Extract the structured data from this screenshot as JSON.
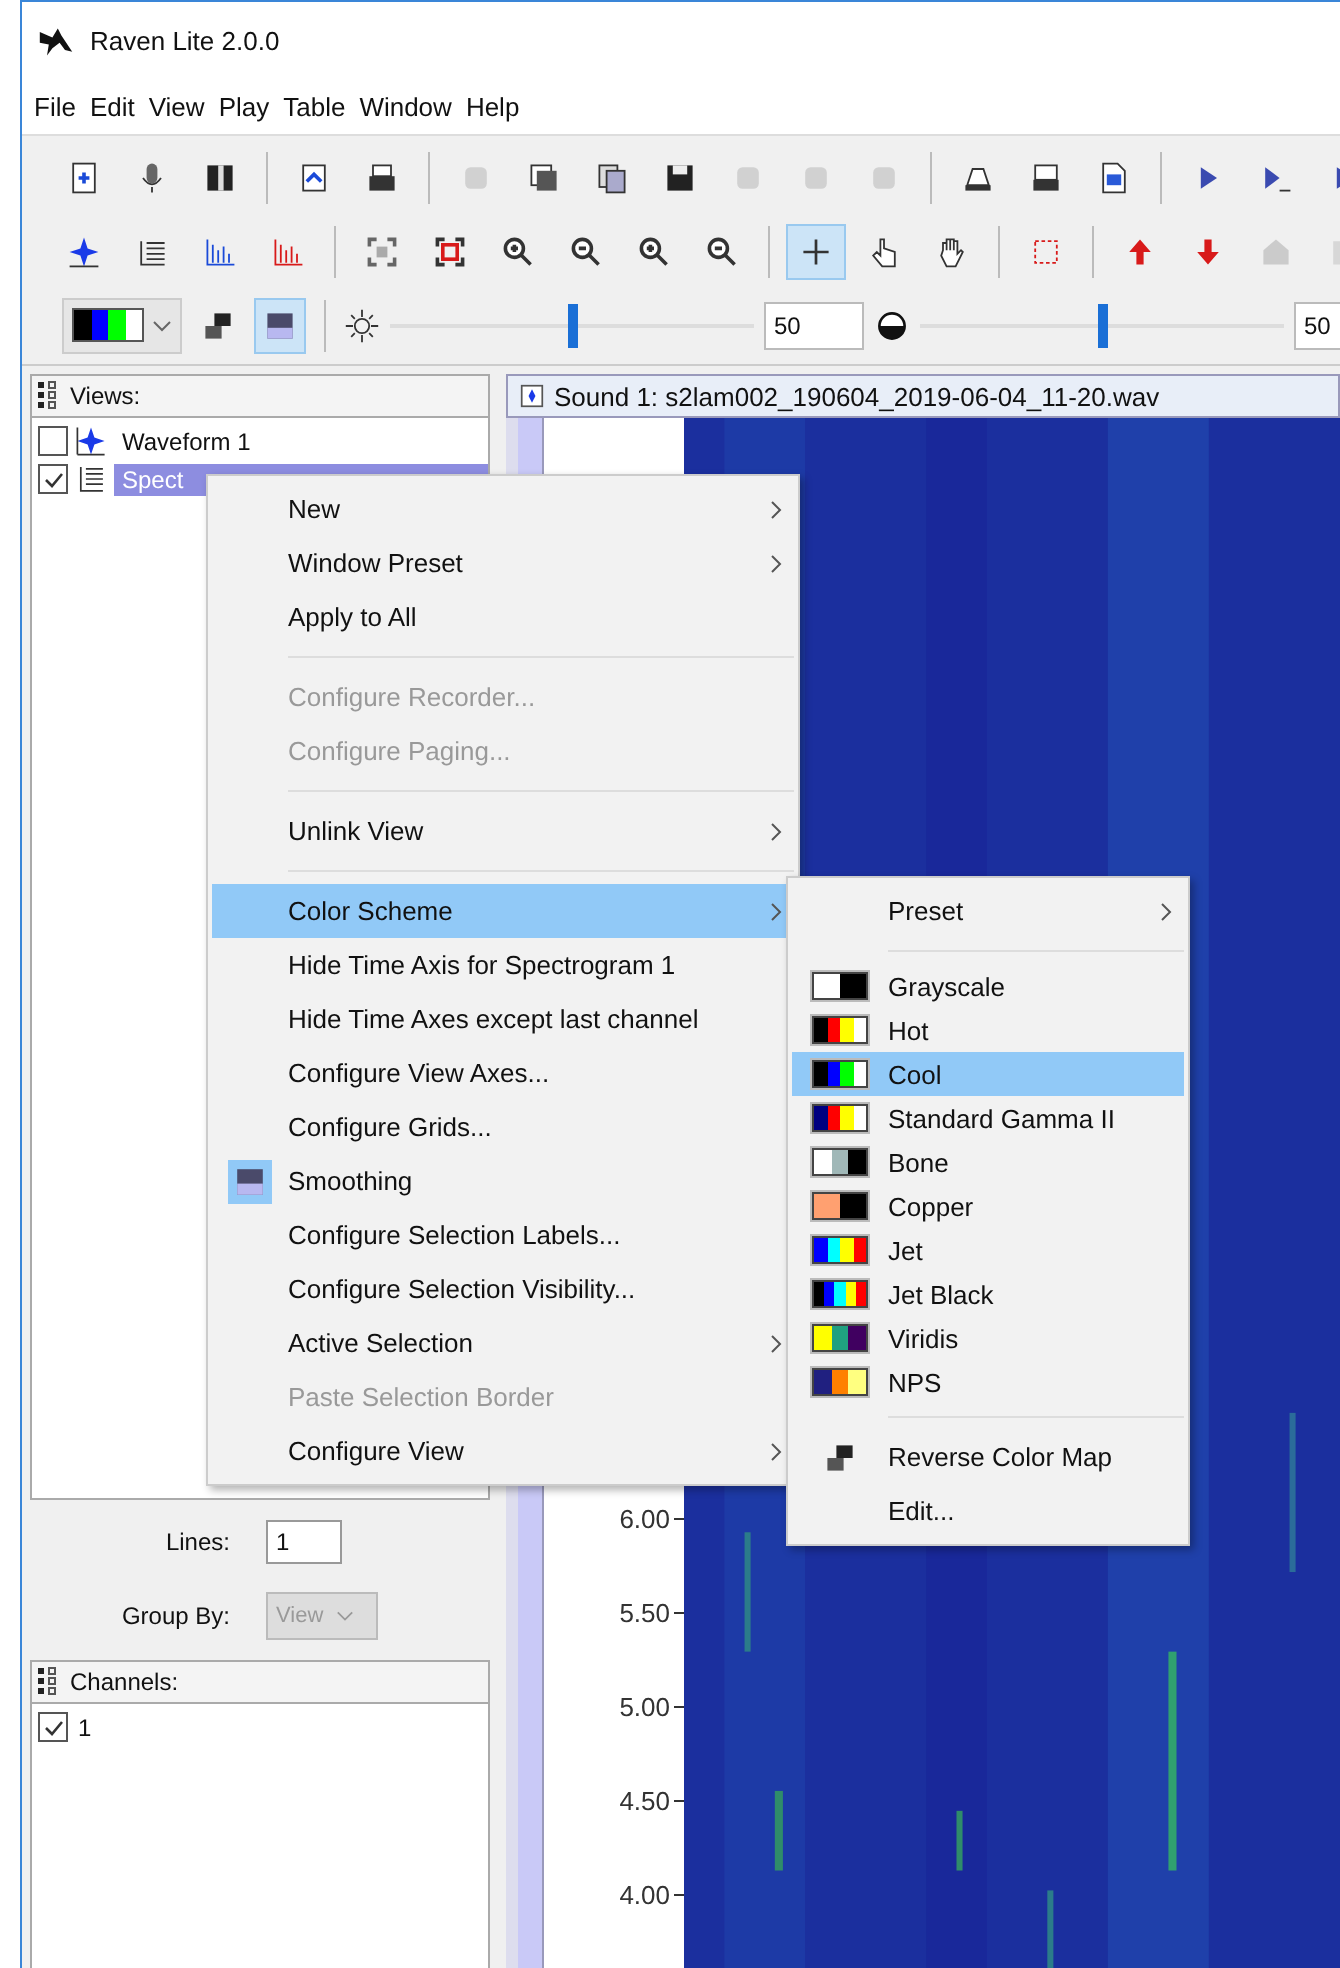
{
  "window": {
    "title": "Raven Lite 2.0.0"
  },
  "menu_bar": [
    "File",
    "Edit",
    "View",
    "Play",
    "Table",
    "Window",
    "Help"
  ],
  "toolbar_rows": [
    [
      {
        "kind": "button",
        "disabled": false,
        "selected": false
      },
      {
        "kind": "button",
        "disabled": false,
        "selected": false
      },
      {
        "kind": "button",
        "disabled": false,
        "selected": false
      },
      {
        "kind": "separator"
      },
      {
        "kind": "button",
        "disabled": false,
        "selected": false
      },
      {
        "kind": "button",
        "disabled": false,
        "selected": false
      },
      {
        "kind": "separator"
      },
      {
        "kind": "button",
        "disabled": true,
        "selected": false
      },
      {
        "kind": "button",
        "disabled": false,
        "selected": false
      },
      {
        "kind": "button",
        "disabled": false,
        "selected": false
      },
      {
        "kind": "button",
        "disabled": false,
        "selected": false
      },
      {
        "kind": "button",
        "disabled": true,
        "selected": false
      },
      {
        "kind": "button",
        "disabled": true,
        "selected": false
      },
      {
        "kind": "button",
        "disabled": true,
        "selected": false
      },
      {
        "kind": "separator"
      },
      {
        "kind": "button",
        "disabled": false,
        "selected": false
      },
      {
        "kind": "button",
        "disabled": false,
        "selected": false
      },
      {
        "kind": "button",
        "disabled": false,
        "selected": false
      },
      {
        "kind": "separator"
      },
      {
        "kind": "button",
        "disabled": false,
        "selected": false
      },
      {
        "kind": "button",
        "disabled": false,
        "selected": false
      },
      {
        "kind": "button",
        "disabled": false,
        "selected": false
      }
    ],
    [
      {
        "kind": "button",
        "disabled": false,
        "selected": false
      },
      {
        "kind": "button",
        "disabled": false,
        "selected": false
      },
      {
        "kind": "button",
        "disabled": false,
        "selected": false
      },
      {
        "kind": "button",
        "disabled": false,
        "selected": false
      },
      {
        "kind": "separator"
      },
      {
        "kind": "button",
        "disabled": false,
        "selected": false
      },
      {
        "kind": "button",
        "disabled": false,
        "selected": false
      },
      {
        "kind": "button",
        "disabled": false,
        "selected": false
      },
      {
        "kind": "button",
        "disabled": false,
        "selected": false
      },
      {
        "kind": "button",
        "disabled": false,
        "selected": false
      },
      {
        "kind": "button",
        "disabled": false,
        "selected": false
      },
      {
        "kind": "separator"
      },
      {
        "kind": "button",
        "disabled": false,
        "selected": true
      },
      {
        "kind": "button",
        "disabled": false,
        "selected": false
      },
      {
        "kind": "button",
        "disabled": false,
        "selected": false
      },
      {
        "kind": "separator"
      },
      {
        "kind": "button",
        "disabled": false,
        "selected": false
      },
      {
        "kind": "separator"
      },
      {
        "kind": "button",
        "disabled": false,
        "selected": false
      },
      {
        "kind": "button",
        "disabled": false,
        "selected": false
      },
      {
        "kind": "button",
        "disabled": true,
        "selected": false
      },
      {
        "kind": "button",
        "disabled": true,
        "selected": false
      }
    ]
  ],
  "display_controls": {
    "color_map": {
      "stops": [
        {
          "color": "#000000"
        },
        {
          "color": "#0000ff"
        },
        {
          "color": "#00ff00"
        },
        {
          "color": "#ffffff"
        }
      ]
    },
    "reverse": {
      "selected": false
    },
    "smoothing": {
      "selected": true
    },
    "brightness": {
      "level": 0.5,
      "value": "50"
    },
    "contrast": {
      "level": 0.5,
      "value": "50"
    }
  },
  "views_panel": {
    "title": "Views:",
    "items": [
      {
        "label": "Waveform 1",
        "kind": "waveform",
        "checked": false,
        "selected": false
      },
      {
        "label": "Spect",
        "kind": "spectrogram",
        "checked": true,
        "selected": true
      }
    ],
    "lines": {
      "label": "Lines:",
      "value": "1"
    },
    "group_by": {
      "label": "Group By:",
      "value": "View",
      "disabled": true
    }
  },
  "channels_panel": {
    "title": "Channels:",
    "items": [
      {
        "label": "1",
        "checked": true
      }
    ]
  },
  "sound_window": {
    "title": "Sound 1: s2lam002_190604_2019-06-04_11-20.wav",
    "axis_labels": [
      "6.00",
      "5.50",
      "5.00",
      "4.50",
      "4.00"
    ]
  },
  "context_menu": {
    "items": [
      {
        "kind": "item",
        "label": "New",
        "submenu": true,
        "disabled": false,
        "selected": false
      },
      {
        "kind": "item",
        "label": "Window Preset",
        "submenu": true,
        "disabled": false,
        "selected": false
      },
      {
        "kind": "item",
        "label": "Apply to All",
        "submenu": false,
        "disabled": false,
        "selected": false
      },
      {
        "kind": "separator"
      },
      {
        "kind": "item",
        "label": "Configure Recorder...",
        "submenu": false,
        "disabled": true,
        "selected": false
      },
      {
        "kind": "item",
        "label": "Configure Paging...",
        "submenu": false,
        "disabled": true,
        "selected": false
      },
      {
        "kind": "separator"
      },
      {
        "kind": "item",
        "label": "Unlink View",
        "submenu": true,
        "disabled": false,
        "selected": false
      },
      {
        "kind": "separator"
      },
      {
        "kind": "item",
        "label": "Color Scheme",
        "submenu": true,
        "disabled": false,
        "selected": true
      },
      {
        "kind": "item",
        "label": "Hide Time Axis for Spectrogram 1",
        "submenu": false,
        "disabled": false,
        "selected": false
      },
      {
        "kind": "item",
        "label": "Hide Time Axes except last channel",
        "submenu": false,
        "disabled": false,
        "selected": false
      },
      {
        "kind": "item",
        "label": "Configure View Axes...",
        "submenu": false,
        "disabled": false,
        "selected": false
      },
      {
        "kind": "item",
        "label": "Configure Grids...",
        "submenu": false,
        "disabled": false,
        "selected": false
      },
      {
        "kind": "toggle",
        "label": "Smoothing",
        "checked": true,
        "submenu": false,
        "disabled": false,
        "selected": false
      },
      {
        "kind": "item",
        "label": "Configure Selection Labels...",
        "submenu": false,
        "disabled": false,
        "selected": false
      },
      {
        "kind": "item",
        "label": "Configure Selection Visibility...",
        "submenu": false,
        "disabled": false,
        "selected": false
      },
      {
        "kind": "item",
        "label": "Active Selection",
        "submenu": true,
        "disabled": false,
        "selected": false
      },
      {
        "kind": "item",
        "label": "Paste Selection Border",
        "submenu": false,
        "disabled": true,
        "selected": false
      },
      {
        "kind": "item",
        "label": "Configure View",
        "submenu": true,
        "disabled": false,
        "selected": false
      }
    ]
  },
  "color_scheme_submenu": {
    "items": [
      {
        "kind": "item",
        "label": "Preset",
        "submenu": true,
        "selected": false
      },
      {
        "kind": "separator"
      },
      {
        "kind": "scheme",
        "label": "Grayscale",
        "stops": [
          {
            "color": "#ffffff"
          },
          {
            "color": "#000000"
          }
        ],
        "selected": false
      },
      {
        "kind": "scheme",
        "label": "Hot",
        "stops": [
          {
            "color": "#000000"
          },
          {
            "color": "#ff0000"
          },
          {
            "color": "#ffff00"
          },
          {
            "color": "#ffffff"
          }
        ],
        "selected": false
      },
      {
        "kind": "scheme",
        "label": "Cool",
        "stops": [
          {
            "color": "#000000"
          },
          {
            "color": "#0000ff"
          },
          {
            "color": "#00ff00"
          },
          {
            "color": "#ffffff"
          }
        ],
        "selected": true
      },
      {
        "kind": "scheme",
        "label": "Standard Gamma II",
        "stops": [
          {
            "color": "#000080"
          },
          {
            "color": "#ff0000"
          },
          {
            "color": "#ffff00"
          },
          {
            "color": "#ffffff"
          }
        ],
        "selected": false
      },
      {
        "kind": "scheme",
        "label": "Bone",
        "stops": [
          {
            "color": "#ffffff"
          },
          {
            "color": "#a0b8b8"
          },
          {
            "color": "#000000"
          }
        ],
        "selected": false
      },
      {
        "kind": "scheme",
        "label": "Copper",
        "stops": [
          {
            "color": "#ffa070"
          },
          {
            "color": "#000000"
          }
        ],
        "selected": false
      },
      {
        "kind": "scheme",
        "label": "Jet",
        "stops": [
          {
            "color": "#0000ff"
          },
          {
            "color": "#00ffff"
          },
          {
            "color": "#ffff00"
          },
          {
            "color": "#ff0000"
          }
        ],
        "selected": false
      },
      {
        "kind": "scheme",
        "label": "Jet Black",
        "stops": [
          {
            "color": "#000000"
          },
          {
            "color": "#0000ff"
          },
          {
            "color": "#00ffff"
          },
          {
            "color": "#ffff00"
          },
          {
            "color": "#ff0000"
          }
        ],
        "selected": false
      },
      {
        "kind": "scheme",
        "label": "Viridis",
        "stops": [
          {
            "color": "#ffff00"
          },
          {
            "color": "#20a080"
          },
          {
            "color": "#400060"
          }
        ],
        "selected": false
      },
      {
        "kind": "scheme",
        "label": "NPS",
        "stops": [
          {
            "color": "#202080"
          },
          {
            "color": "#ff8000"
          },
          {
            "color": "#ffff80"
          }
        ],
        "selected": false
      },
      {
        "kind": "separator"
      },
      {
        "kind": "reverse",
        "label": "Reverse Color Map",
        "submenu": false,
        "selected": false
      },
      {
        "kind": "item",
        "label": "Edit...",
        "submenu": false,
        "selected": false
      }
    ]
  }
}
